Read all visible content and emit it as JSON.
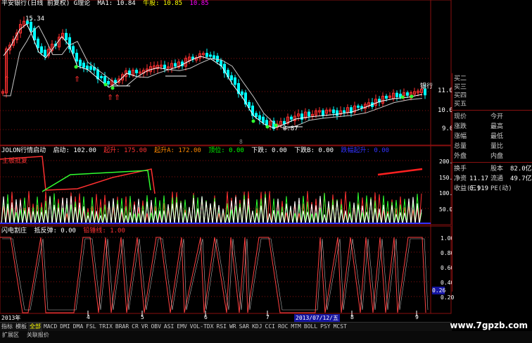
{
  "colors": {
    "up": "#ff3030",
    "down": "#00ffff",
    "ma1": "#ffffff",
    "ma2": "#ffff00",
    "grid": "#8a1010",
    "axis": "#ff4040"
  },
  "panel1": {
    "header": [
      "平安银行(日线 前复权) G理论",
      "MA1: 10.84",
      "牛股: 10.85",
      "10.85"
    ],
    "price_hi_label": "15.34",
    "price_lo_label": "8.87",
    "right_axis": [
      "11.00",
      "10.00",
      "9.00"
    ],
    "sublabel": "银行",
    "x_marker": "8"
  },
  "panel2": {
    "header": [
      "JOLON行情启动",
      "启动: 102.00",
      "起升: 175.00",
      "起升A: 172.00",
      "顶位: 0.00",
      "下跌: 0.00",
      "下跌B: 0.00",
      "跌幅起升: 0.00"
    ],
    "inner_label": "主板批复",
    "right_axis": [
      "200.0",
      "150.0",
      "100.0",
      "50.00"
    ]
  },
  "panel3": {
    "header": [
      "闪电割庄",
      "抵反弹: 0.00",
      "铅锤线: 1.00"
    ],
    "right_axis": [
      "1.00",
      "0.80",
      "0.60",
      "0.40",
      "0.20"
    ],
    "value_box": "0.26"
  },
  "x_axis": {
    "labels": [
      "2013年",
      "4",
      "5",
      "6",
      "7",
      "8",
      "9"
    ],
    "cursor_date": "2013/07/12/五"
  },
  "quote_panel": {
    "asks": [
      "买二",
      "买三",
      "买四",
      "买五"
    ],
    "rows": [
      [
        "现价",
        "",
        "今开",
        ""
      ],
      [
        "涨跌",
        "",
        "最高",
        ""
      ],
      [
        "涨幅",
        "",
        "最低",
        ""
      ],
      [
        "总量",
        "",
        "量比",
        ""
      ],
      [
        "外盘",
        "",
        "内盘",
        ""
      ]
    ],
    "rows2": [
      [
        "换手",
        "",
        "股本",
        "82.0亿"
      ],
      [
        "净资",
        "11.17",
        "流通",
        "49.7亿"
      ],
      [
        "收益(三)",
        "0.919",
        "PE(动)",
        ""
      ]
    ]
  },
  "tabs": [
    "指标",
    "模板",
    "全部",
    "MACD",
    "DMI",
    "DMA",
    "FSL",
    "TRIX",
    "BRAR",
    "CR",
    "VR",
    "OBV",
    "ASI",
    "EMV",
    "VOL-TDX",
    "RSI",
    "WR",
    "SAR",
    "KDJ",
    "CCI",
    "ROC",
    "MTM",
    "BOLL",
    "PSY",
    "MCST"
  ],
  "bottom_tabs": [
    "扩展区",
    "关联报价"
  ],
  "watermark": "www.7gpzb.com"
}
